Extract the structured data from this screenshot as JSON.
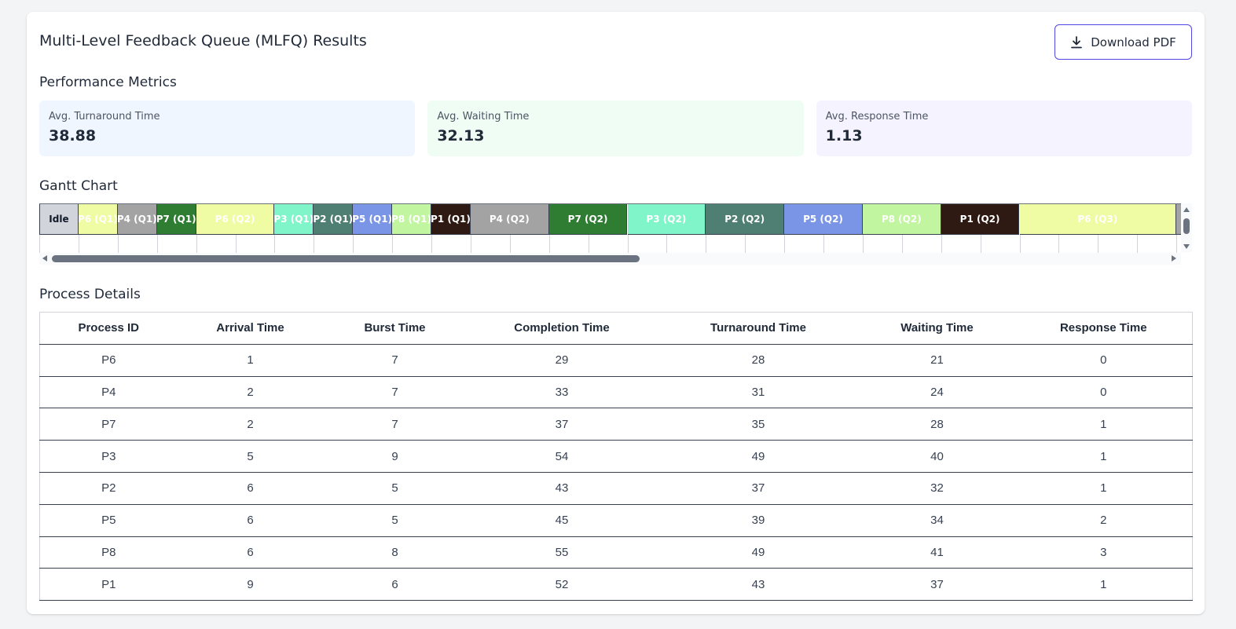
{
  "header": {
    "title": "Multi-Level Feedback Queue (MLFQ) Results",
    "download_label": "Download PDF"
  },
  "metrics": {
    "title": "Performance Metrics",
    "items": [
      {
        "label": "Avg. Turnaround Time",
        "value": "38.88",
        "bg": "#eff6ff"
      },
      {
        "label": "Avg. Waiting Time",
        "value": "32.13",
        "bg": "#f0fdf4"
      },
      {
        "label": "Avg. Response Time",
        "value": "1.13",
        "bg": "#f5f3ff"
      }
    ]
  },
  "gantt": {
    "title": "Gantt Chart",
    "segments": [
      {
        "label": "Idle",
        "duration": 1,
        "color": "#d1d5db",
        "text": "#111827"
      },
      {
        "label": "P6 (Q1)",
        "duration": 1,
        "color": "#f0fca4",
        "text": "#ffffff"
      },
      {
        "label": "P4 (Q1)",
        "duration": 1,
        "color": "#a3a3a3",
        "text": "#ffffff"
      },
      {
        "label": "P7 (Q1)",
        "duration": 1,
        "color": "#2e7d32",
        "text": "#ffffff"
      },
      {
        "label": "P6 (Q2)",
        "duration": 2,
        "color": "#f0fca4",
        "text": "#ffffff"
      },
      {
        "label": "P3 (Q1)",
        "duration": 1,
        "color": "#7ff5c9",
        "text": "#ffffff"
      },
      {
        "label": "P2 (Q1)",
        "duration": 1,
        "color": "#4f7f73",
        "text": "#ffffff"
      },
      {
        "label": "P5 (Q1)",
        "duration": 1,
        "color": "#7b95e6",
        "text": "#ffffff"
      },
      {
        "label": "P8 (Q1)",
        "duration": 1,
        "color": "#c2f5a0",
        "text": "#ffffff"
      },
      {
        "label": "P1 (Q1)",
        "duration": 1,
        "color": "#2e1a12",
        "text": "#ffffff"
      },
      {
        "label": "P4 (Q2)",
        "duration": 2,
        "color": "#a3a3a3",
        "text": "#ffffff"
      },
      {
        "label": "P7 (Q2)",
        "duration": 2,
        "color": "#2e7d32",
        "text": "#ffffff"
      },
      {
        "label": "P3 (Q2)",
        "duration": 2,
        "color": "#7ff5c9",
        "text": "#ffffff"
      },
      {
        "label": "P2 (Q2)",
        "duration": 2,
        "color": "#4f7f73",
        "text": "#ffffff"
      },
      {
        "label": "P5 (Q2)",
        "duration": 2,
        "color": "#7b95e6",
        "text": "#ffffff"
      },
      {
        "label": "P8 (Q2)",
        "duration": 2,
        "color": "#c2f5a0",
        "text": "#ffffff"
      },
      {
        "label": "P1 (Q2)",
        "duration": 2,
        "color": "#2e1a12",
        "text": "#ffffff"
      },
      {
        "label": "P6 (Q3)",
        "duration": 4,
        "color": "#f0fca4",
        "text": "#ffffff"
      },
      {
        "label": "",
        "duration": 0.15,
        "color": "#a3a3a3",
        "text": "#ffffff"
      }
    ]
  },
  "details": {
    "title": "Process Details",
    "columns": [
      "Process ID",
      "Arrival Time",
      "Burst Time",
      "Completion Time",
      "Turnaround Time",
      "Waiting Time",
      "Response Time"
    ],
    "rows": [
      [
        "P6",
        "1",
        "7",
        "29",
        "28",
        "21",
        "0"
      ],
      [
        "P4",
        "2",
        "7",
        "33",
        "31",
        "24",
        "0"
      ],
      [
        "P7",
        "2",
        "7",
        "37",
        "35",
        "28",
        "1"
      ],
      [
        "P3",
        "5",
        "9",
        "54",
        "49",
        "40",
        "1"
      ],
      [
        "P2",
        "6",
        "5",
        "43",
        "37",
        "32",
        "1"
      ],
      [
        "P5",
        "6",
        "5",
        "45",
        "39",
        "34",
        "2"
      ],
      [
        "P8",
        "6",
        "8",
        "55",
        "49",
        "41",
        "3"
      ],
      [
        "P1",
        "9",
        "6",
        "52",
        "43",
        "37",
        "1"
      ]
    ]
  }
}
